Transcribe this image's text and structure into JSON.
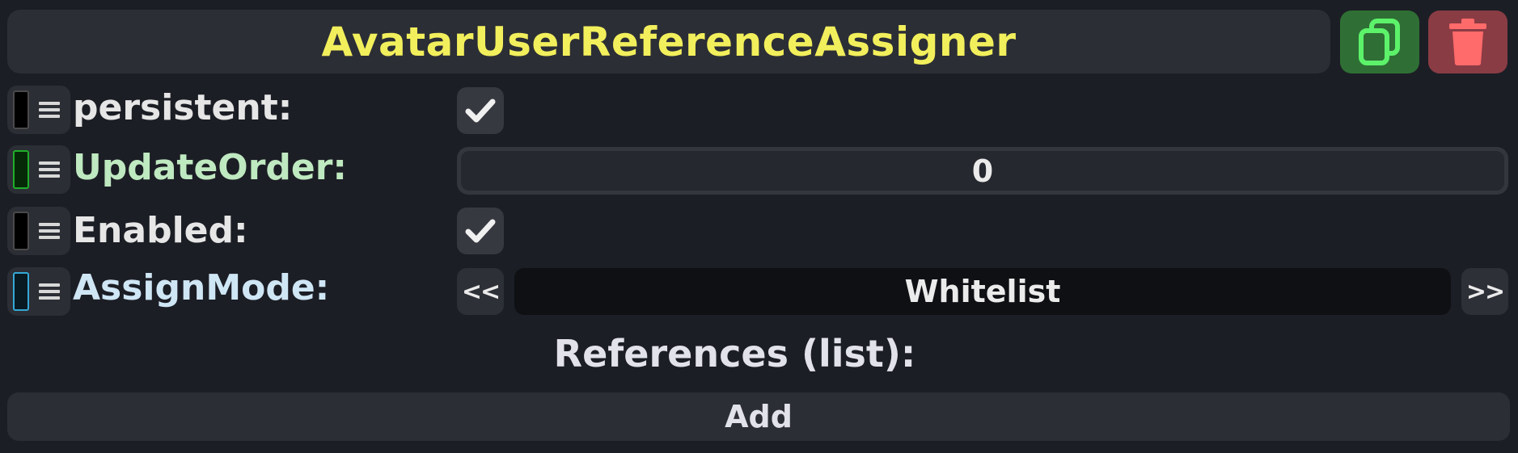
{
  "header": {
    "title": "AvatarUserReferenceAssigner",
    "duplicate_icon": "duplicate-icon",
    "delete_icon": "trash-icon",
    "title_color": "#f2ef5c"
  },
  "fields": [
    {
      "label": "persistent:",
      "type": "checkbox",
      "checked": true,
      "label_color": "#e6e6e6",
      "swatch_color": "#000000"
    },
    {
      "label": "UpdateOrder:",
      "type": "number",
      "value": "0",
      "label_color": "#bfe9c0",
      "swatch_color": "#1fae2a"
    },
    {
      "label": "Enabled:",
      "type": "checkbox",
      "checked": true,
      "label_color": "#e6e6e6",
      "swatch_color": "#000000"
    },
    {
      "label": "AssignMode:",
      "type": "enum",
      "value": "Whitelist",
      "prev_label": "<<",
      "next_label": ">>",
      "label_color": "#cfe6f5",
      "swatch_color": "#35a9d6"
    }
  ],
  "list": {
    "title": "References (list):",
    "add_label": "Add"
  }
}
